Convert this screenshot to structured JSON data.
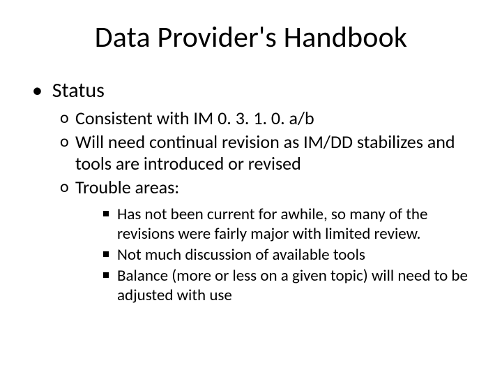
{
  "title": "Data Provider's Handbook",
  "bullets": {
    "l1": "Status",
    "l2": [
      "Consistent with IM 0. 3. 1. 0. a/b",
      "Will need continual revision as IM/DD stabilizes and tools are introduced or revised",
      "Trouble areas:"
    ],
    "l3": [
      "Has not been current for awhile, so many of the revisions were fairly major with limited review.",
      "Not much discussion of available tools",
      "Balance (more or less on a given topic) will need to be adjusted with use"
    ]
  }
}
